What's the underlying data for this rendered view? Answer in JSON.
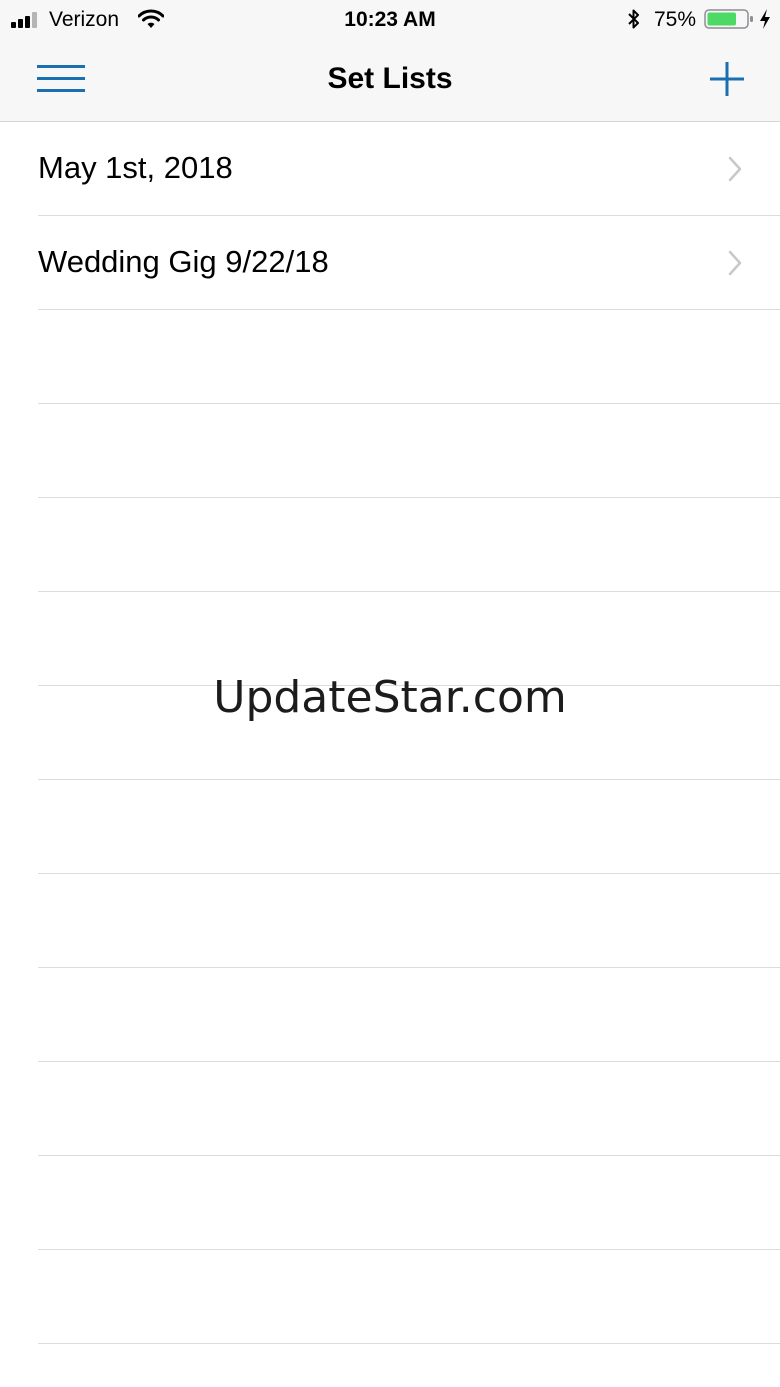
{
  "status_bar": {
    "carrier": "Verizon",
    "time": "10:23 AM",
    "battery_percent": "75%",
    "battery_level": 0.75,
    "battery_color": "#4cd964"
  },
  "nav": {
    "title": "Set Lists",
    "menu_icon": "hamburger-menu-icon",
    "add_icon": "plus-icon",
    "accent_color": "#1a6fb0"
  },
  "set_lists": [
    {
      "label": "May 1st, 2018"
    },
    {
      "label": "Wedding Gig 9/22/18"
    }
  ],
  "watermark": "UpdateStar.com"
}
